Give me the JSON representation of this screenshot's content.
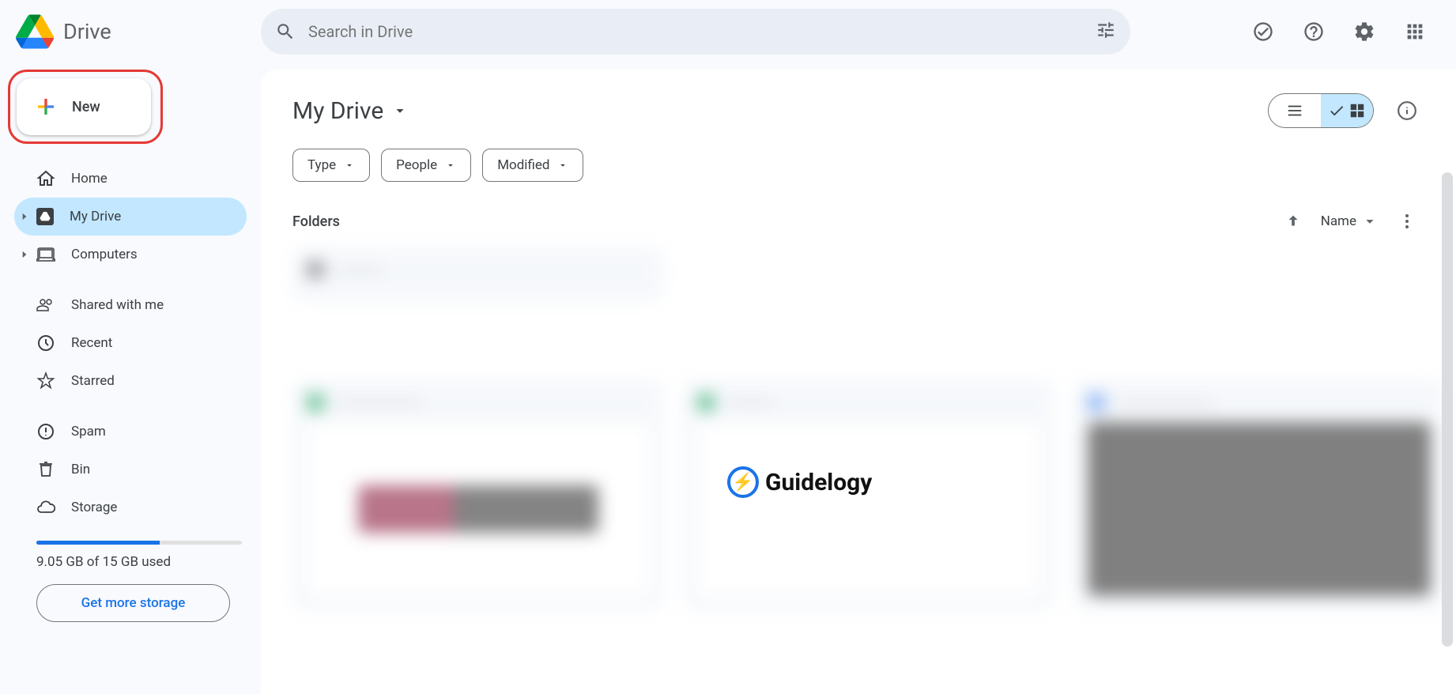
{
  "app": {
    "title": "Drive"
  },
  "search": {
    "placeholder": "Search in Drive"
  },
  "sidebar": {
    "new_label": "New",
    "items": [
      {
        "label": "Home"
      },
      {
        "label": "My Drive"
      },
      {
        "label": "Computers"
      },
      {
        "label": "Shared with me"
      },
      {
        "label": "Recent"
      },
      {
        "label": "Starred"
      },
      {
        "label": "Spam"
      },
      {
        "label": "Bin"
      },
      {
        "label": "Storage"
      }
    ],
    "storage_used_text": "9.05 GB of 15 GB used",
    "storage_percent": 60,
    "get_more": "Get more storage"
  },
  "main": {
    "breadcrumb": "My Drive",
    "filters": [
      {
        "label": "Type"
      },
      {
        "label": "People"
      },
      {
        "label": "Modified"
      }
    ],
    "section": "Folders",
    "sort_label": "Name"
  },
  "watermark": {
    "text": "Guidelogy"
  }
}
